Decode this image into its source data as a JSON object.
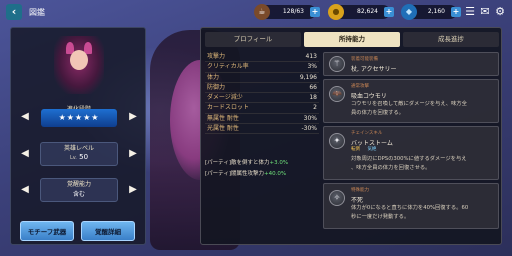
{
  "header": {
    "title": "図鑑",
    "stamina": "128/63",
    "gold": "82,624",
    "gems": "2,160",
    "plus": "+"
  },
  "left": {
    "evolution_label": "進化段階",
    "stars": "★★★★★",
    "level_label": "英雄レベル",
    "level_prefix": "Lv.",
    "level_value": "50",
    "awaken_label": "覚醒能力",
    "awaken_value": "含む",
    "motif_button": "モチーフ武器",
    "awaken_detail_button": "覚醒詳細"
  },
  "tabs": [
    {
      "label": "プロフィール"
    },
    {
      "label": "所持能力"
    },
    {
      "label": "成長進捗"
    }
  ],
  "stats": [
    {
      "k": "攻撃力",
      "v": "413"
    },
    {
      "k": "クリティカル率",
      "v": "3%"
    },
    {
      "k": "体力",
      "v": "9,196"
    },
    {
      "k": "防御力",
      "v": "66"
    },
    {
      "k": "ダメージ減少",
      "v": "18"
    },
    {
      "k": "カードスロット",
      "v": "2"
    },
    {
      "k": "無属性 耐性",
      "v": "30%"
    },
    {
      "k": "光属性 耐性",
      "v": "-30%"
    }
  ],
  "bonuses": {
    "b1_text": "[パーティ]敵を倒すと体力",
    "b1_val": "+3.0%",
    "b2_text": "[パーティ]闇属性攻撃力",
    "b2_val": "+40.0%"
  },
  "skills": {
    "s1_head": "装着可能装備",
    "s1_name": "杖, アクセサリー",
    "s2_head": "通常攻撃",
    "s2_name": "吸血コウモリ",
    "s2_desc1": "コウモリを召喚して敵にダメージを与え、味方全",
    "s2_desc2": "員の体力を回復する。",
    "s3_head": "チェインスキル",
    "s3_name": "バットストーム",
    "s3_tag1": "転倒",
    "s3_tag2": "気絶",
    "s3_desc1": "対象周辺にDPSの300%に値するダメージを与え",
    "s3_desc2": "、味方全員の体力を回復させる。",
    "s4_head": "特殊能力",
    "s4_name": "不死",
    "s4_desc1": "体力が0になると直ちに体力を40%回復する。60",
    "s4_desc2": "秒に一度だけ発動する。"
  },
  "colors": {
    "accent_tab": "#efe3c2",
    "stat_key": "#e0b97a",
    "bonus_green": "#6fe07a",
    "skill_head": "#c98655"
  },
  "icons": [
    "back-arrow-icon",
    "coffee-icon",
    "gold-coin-icon",
    "diamond-icon",
    "list-icon",
    "mail-icon",
    "gear-icon",
    "bat-icon",
    "chain-icon",
    "claw-icon"
  ]
}
